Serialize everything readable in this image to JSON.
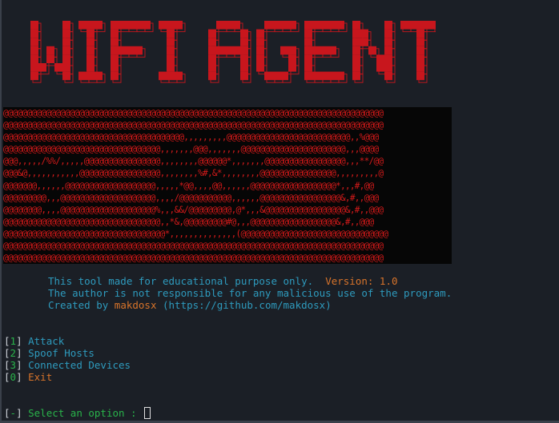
{
  "title_banner": "WIFI AGENT",
  "ascii_art": [
    "@@@@@@@@@@@@@@@@@@@@@@@@@@@@@@@@@@@@@@@@@@@@@@@@@@@@@@@@@@@@@@@@@@@@@@@@@@@@@@@@",
    "@@@@@@@@@@@@@@@@@@@@@@@@@@@@@@@@@@@@@@@@@@@@@@@@@@@@@@@@@@@@@@@@@@@@@@@@@@@@@@@@",
    "@@@@@@@@@@@@@@@@@@@@@@@@@@@@@@@@@@@@@@,,,,,,,,,@@@@@@@@@@@@@@@@@@@@@@@@@@,,%@@@",
    "@@@@@@@@@@@@@@@@@@@@@@@@@@@@@@@@@,,,,,,,@@@,,,,,,,@@@@@@@@@@@@@@@@@@@@@@,,,@@@@",
    "@@@,,,,,/%%/,,,,,@@@@@@@@@@@@@@@@,,,,,,,,@@@@@@*,,,,,,,@@@@@@@@@@@@@@@@@,,,**/@@",
    "@@@&@,,,,,,,,,,,@@@@@@@@@@@@@@@@@,,,,,,,,%#,&*,,,,,,,,@@@@@@@@@@@@@@@@,,,,,,,,,@",
    "@@@@@@@,,,,,,@@@@@@@@@@@@@@@@@@@,,,,,*@@,,,,@@,,,,,,@@@@@@@@@@@@@@@@@@*,,,#,@@",
    "@@@@@@@@@,,,@@@@@@@@@@@@@@@@@@@@,,,,/@@@@@@@@@@@,,,,,,@@@@@@@@@@@@@@@@@&,#,,@@@",
    "@@@@@@@@,,,,@@@@@@@@@@@@@@@@@@@@%,,,&&/@@@@@@@@@,@*,,,&@@@@@@@@@@@@@@@@@&,#,,@@@",
    "@@@@@@@@@@@@@@@@@@@@@@@@@@@@@@@@@,,*&,@@@@@@@@@#@,,,@@@@@@@@@@@@@@@@@@&,#,,@@@",
    "@@@@@@@@@@@@@@@@@@@@@@@@@@@@@@@@@@*,,,,,,,,,,,,,,(@@@@@@@@@@@@@@@@@@@@@@@@@@@@@@@",
    "@@@@@@@@@@@@@@@@@@@@@@@@@@@@@@@@@@@@@@@@@@@@@@@@@@@@@@@@@@@@@@@@@@@@@@@@@@@@@@@@",
    "@@@@@@@@@@@@@@@@@@@@@@@@@@@@@@@@@@@@@@@@@@@@@@@@@@@@@@@@@@@@@@@@@@@@@@@@@@@@@@@@"
  ],
  "info": {
    "line1_text": "This tool made for educational purpose only.",
    "version": "Version: 1.0",
    "line2_text": "The author is not responsible for any malicious use of the program.",
    "created_prefix": "Created by ",
    "author": "makdosx",
    "url": " (https://github.com/makdosx)"
  },
  "menu": [
    {
      "number": "1",
      "label": "Attack"
    },
    {
      "number": "2",
      "label": "Spoof Hosts"
    },
    {
      "number": "3",
      "label": "Connected Devices"
    },
    {
      "number": "0",
      "label": "Exit"
    }
  ],
  "prompt": {
    "marker": "-",
    "text": "Select an option : "
  },
  "colors": {
    "background": "#1b1f26",
    "banner_red": "#c8161d",
    "ascii_red": "#d21a1a",
    "info_cyan": "#2e9bbe",
    "accent_orange": "#d9742a",
    "menu_green": "#29b34a"
  }
}
